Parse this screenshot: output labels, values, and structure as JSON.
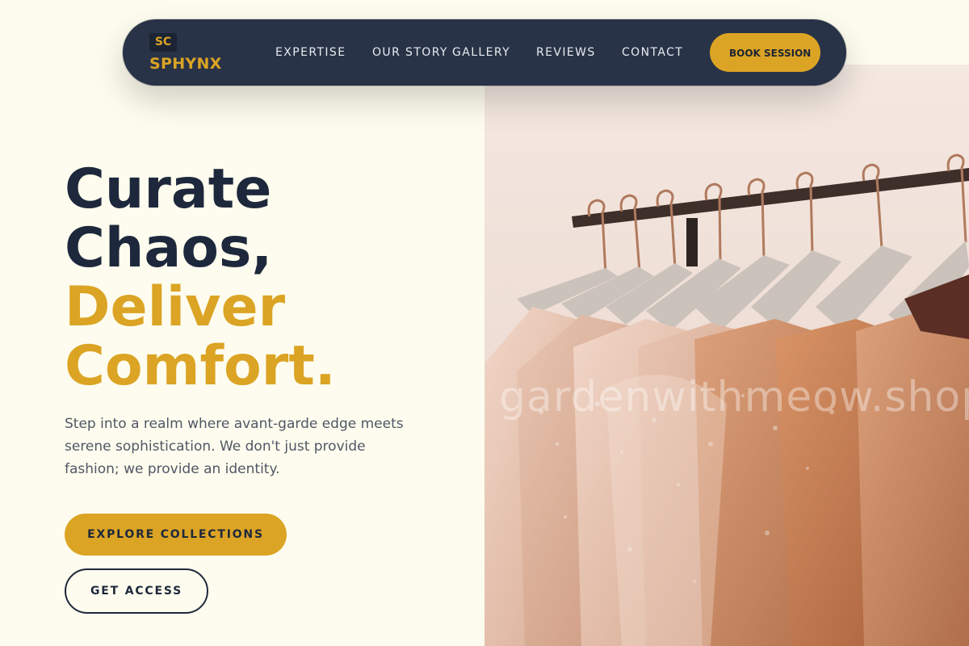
{
  "brand": {
    "badge": "SC",
    "name": "SPHYNX"
  },
  "nav": {
    "links": [
      "EXPERTISE",
      "OUR STORY",
      "GALLERY",
      "REVIEWS",
      "CONTACT"
    ],
    "cta": "BOOK SESSION"
  },
  "hero": {
    "headline_line1": "Curate",
    "headline_line2": "Chaos,",
    "headline_line3": "Deliver",
    "headline_line4": "Comfort.",
    "description": "Step into a realm where avant-garde edge meets serene sophistication. We don't just provide fashion; we provide an identity.",
    "primary_button": "EXPLORE COLLECTIONS",
    "secondary_button": "GET ACCESS",
    "image_watermark": "gardenwithmeow.shop"
  },
  "colors": {
    "background": "#fdfcee",
    "navbar": "#283347",
    "accent_gold": "#dca424",
    "text_dark": "#1e283c",
    "text_muted": "#505765"
  }
}
